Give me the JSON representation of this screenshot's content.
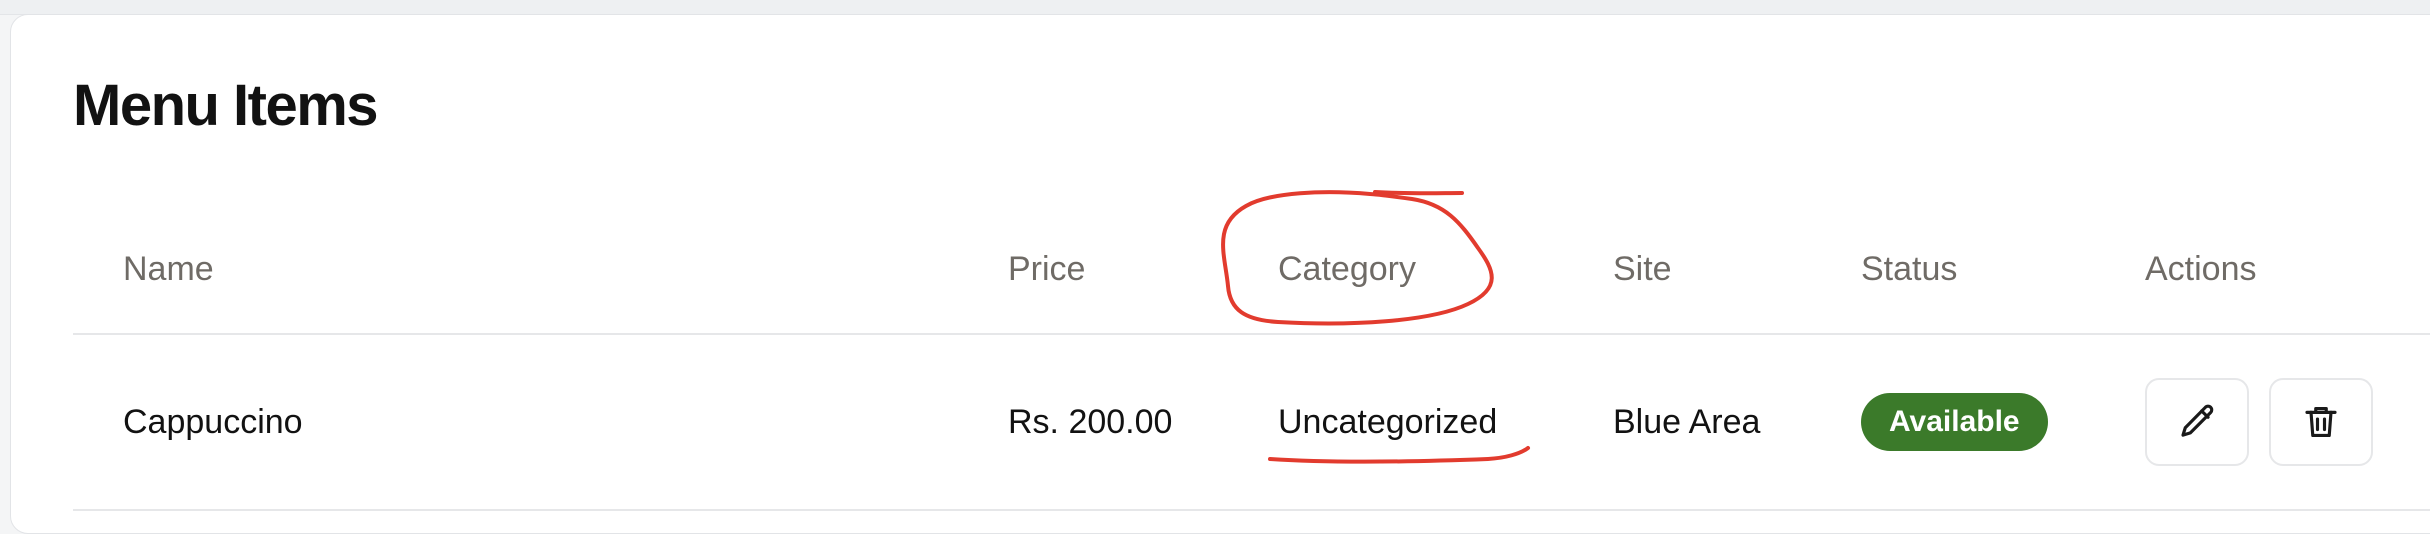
{
  "page": {
    "title": "Menu Items"
  },
  "table": {
    "headers": {
      "name": "Name",
      "price": "Price",
      "category": "Category",
      "site": "Site",
      "status": "Status",
      "actions": "Actions"
    },
    "rows": [
      {
        "name": "Cappuccino",
        "price": "Rs. 200.00",
        "category": "Uncategorized",
        "site": "Blue Area",
        "status": "Available",
        "status_color": "#3b7a2a",
        "actions": [
          "pencil-icon",
          "trash-icon"
        ]
      }
    ]
  },
  "annotations": {
    "color": "#e23b2e",
    "circled": "table.headers.category",
    "underlined": "table.rows.0.category"
  }
}
